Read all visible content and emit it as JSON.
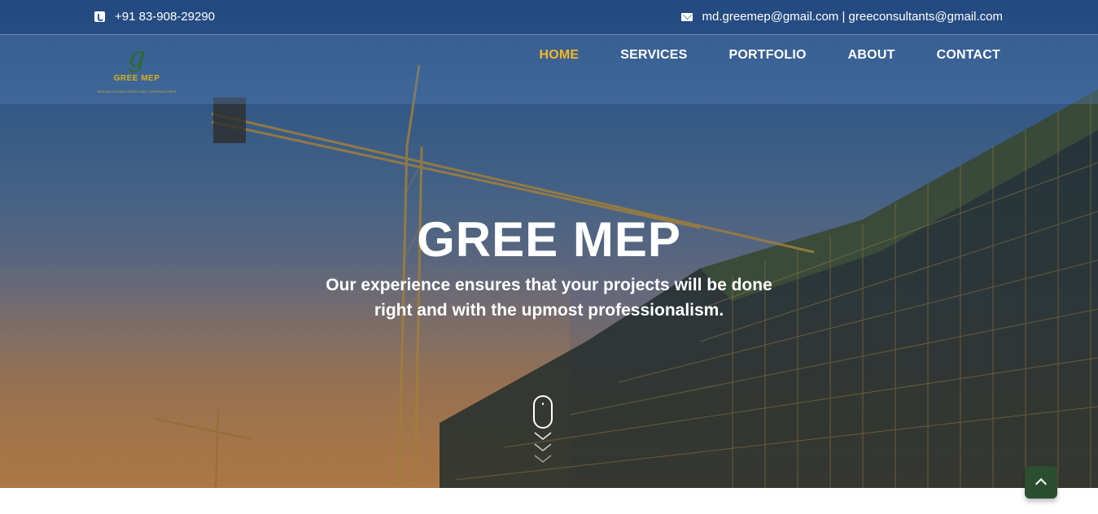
{
  "topbar": {
    "phone": "+91 83-908-29290",
    "email": "md.greemep@gmail.com | greeconsultants@gmail.com",
    "phone_icon": "phone-square-icon",
    "email_icon": "envelope-icon"
  },
  "logo": {
    "letter": "g",
    "name": "GREE MEP",
    "tagline": "DESIGN CONSULTANTS AND CONTRACTORS"
  },
  "nav": {
    "items": [
      {
        "label": "HOME",
        "active": true
      },
      {
        "label": "SERVICES",
        "active": false
      },
      {
        "label": "PORTFOLIO",
        "active": false
      },
      {
        "label": "ABOUT",
        "active": false
      },
      {
        "label": "CONTACT",
        "active": false
      }
    ]
  },
  "hero": {
    "title": "GREE MEP",
    "subtitle_line1": "Our experience ensures that your projects will be done",
    "subtitle_line2": "right and with the upmost professionalism.",
    "scroll_icon": "mouse-scroll-icon",
    "chevrons_icon": "chevron-down-icon"
  },
  "back_to_top": {
    "icon": "chevron-up-icon"
  },
  "colors": {
    "accent": "#f5b820",
    "nav_text": "#ffffff",
    "back_to_top_bg": "#2c4e30",
    "logo_green": "#2f6b2a",
    "logo_gold": "#d7b21e"
  }
}
